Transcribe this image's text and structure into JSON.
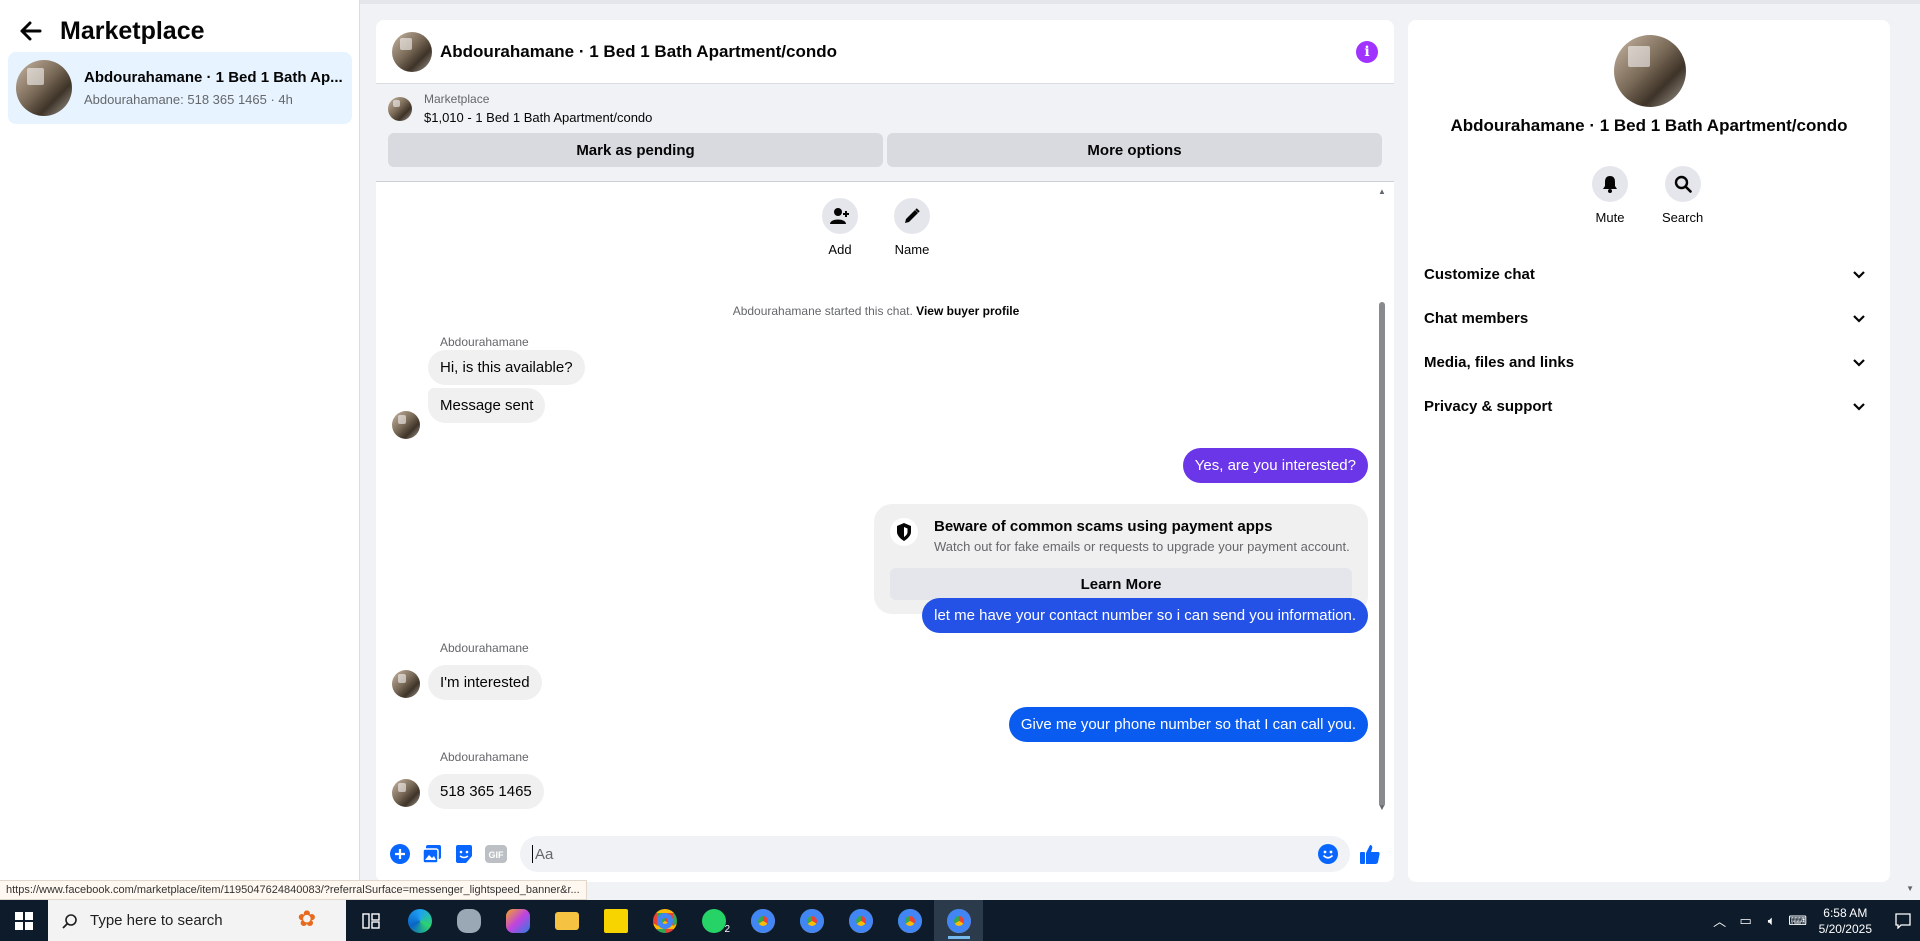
{
  "sidebar": {
    "title": "Marketplace",
    "conversation": {
      "name": "Abdourahamane · 1 Bed 1 Bath Ap...",
      "preview": "Abdourahamane: 518 365 1465 · 4h"
    }
  },
  "chat": {
    "title": "Abdourahamane · 1 Bed 1 Bath Apartment/condo",
    "listing": {
      "label": "Marketplace",
      "price": "$1,010 - 1 Bed 1 Bath Apartment/condo",
      "pending_button": "Mark as pending",
      "more_button": "More options"
    },
    "actions": {
      "add": "Add",
      "name": "Name"
    },
    "system": {
      "text": "Abdourahamane started this chat.",
      "link": "View buyer profile"
    },
    "messages": [
      {
        "sender": "Abdourahamane",
        "text": "Hi, is this available?"
      },
      {
        "text": "Message sent"
      },
      {
        "text": "Yes, are you interested?"
      },
      {
        "text": "let me have your contact number so i can send you information."
      },
      {
        "sender": "Abdourahamane",
        "text": "I'm interested"
      },
      {
        "text": "Give me your phone number so that I can call you."
      },
      {
        "sender": "Abdourahamane",
        "text": "518 365 1465"
      }
    ],
    "scam_card": {
      "title": "Beware of common scams using payment apps",
      "subtitle": "Watch out for fake emails or requests to upgrade your payment account.",
      "button": "Learn More"
    },
    "composer": {
      "placeholder": "Aa",
      "gif_label": "GIF"
    }
  },
  "info_panel": {
    "name": "Abdourahamane · 1 Bed 1 Bath Apartment/condo",
    "mute": "Mute",
    "search": "Search",
    "sections": [
      "Customize chat",
      "Chat members",
      "Media, files and links",
      "Privacy & support"
    ]
  },
  "status_url": "https://www.facebook.com/marketplace/item/1195047624840083/?referralSurface=messenger_lightspeed_banner&r...",
  "taskbar": {
    "search_placeholder": "Type here to search",
    "whatsapp_badge": "2",
    "time": "6:58 AM",
    "date": "5/20/2025"
  },
  "colors": {
    "accent_purple": "#a033ff",
    "bubble_purple": "#6b36e8",
    "bubble_blue": "#0a5cf0",
    "messenger_blue": "#0866ff",
    "selected_bg": "#e7f3ff"
  }
}
